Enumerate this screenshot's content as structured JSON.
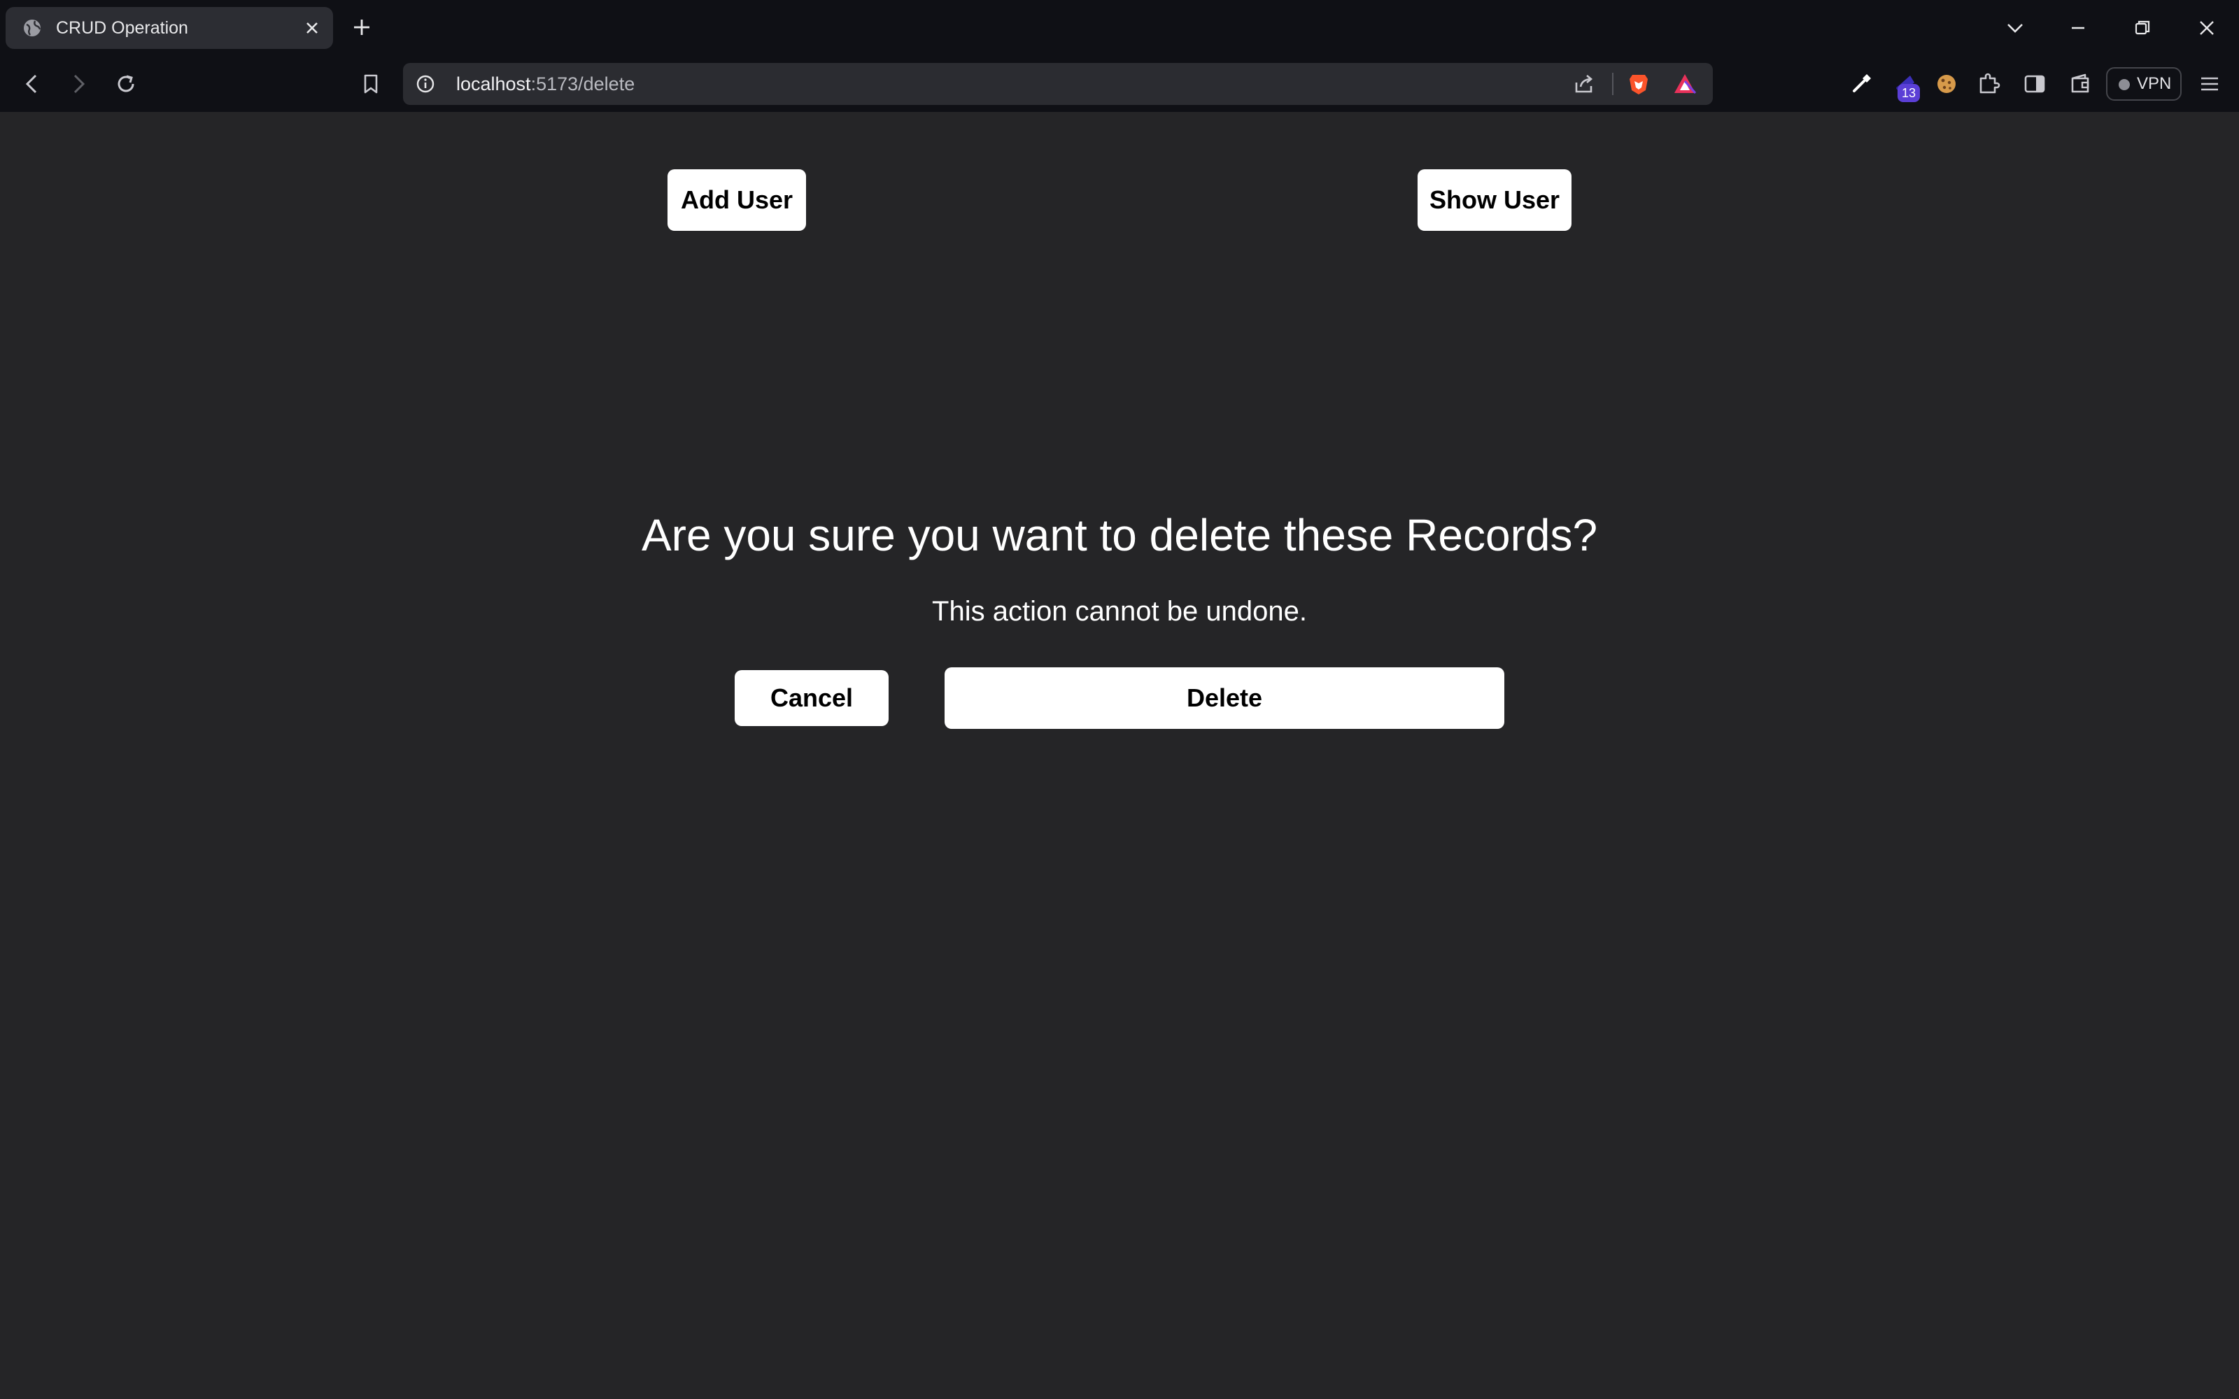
{
  "browser": {
    "tab_title": "CRUD Operation",
    "url_host": "localhost",
    "url_path": ":5173/delete",
    "vpn_label": "VPN",
    "extension_badge": "13",
    "icons": {
      "tab": "globe-icon",
      "tab_close": "close-icon",
      "new_tab": "plus-icon",
      "tab_list": "chevron-down-icon",
      "minimize": "minimize-icon",
      "restore": "restore-icon",
      "window_close": "close-icon",
      "back": "back-arrow-icon",
      "forward": "forward-arrow-icon",
      "reload": "reload-icon",
      "bookmark": "bookmark-icon",
      "site_info": "info-icon",
      "share": "share-icon",
      "brave_shields": "brave-lion-icon",
      "rewards": "rewards-triangle-icon",
      "eyedropper": "eyedropper-icon",
      "extension": "wizard-hat-icon",
      "cookie": "cookie-icon",
      "extensions": "puzzle-icon",
      "sidebar": "sidebar-icon",
      "wallet": "wallet-icon",
      "menu": "hamburger-menu-icon"
    },
    "colors": {
      "chrome": "#0f1015",
      "tab": "#2c2d33",
      "urlbar": "#2b2c31",
      "brave": "#fb542b",
      "badge": "#5b3fd6"
    }
  },
  "page": {
    "background": "#252527",
    "nav": {
      "add_user": "Add User",
      "show_user": "Show User"
    },
    "dialog": {
      "heading": "Are you sure you want to delete these Records?",
      "subtext": "This action cannot be undone.",
      "cancel": "Cancel",
      "delete": "Delete"
    }
  }
}
